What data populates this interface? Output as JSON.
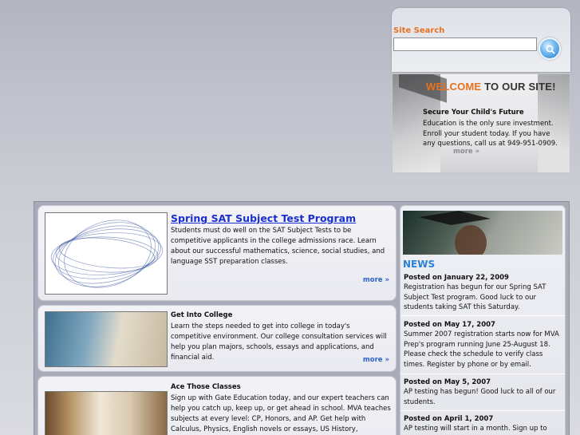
{
  "search": {
    "label": "Site Search",
    "value": "",
    "placeholder": ""
  },
  "welcome": {
    "title_part1": "WELCOME",
    "title_part2": "TO OUR SITE!",
    "subtitle": "Secure Your Child's Future",
    "body": "Education is the only sure investment. Enroll your student today. If you have any questions, call us at 949-951-0909.",
    "more": "more »"
  },
  "cards": [
    {
      "title": "Spring SAT Subject Test Program",
      "body": "Students must do well on the SAT Subject Tests to be competitive applicants in the college admissions race. Learn about our successful mathematics, science, social studies, and language SST preparation classes.",
      "more": "more »"
    },
    {
      "title": "Get Into College",
      "body": "Learn the steps needed to get into college in today's competitive environment. Our college consultation services will help you plan majors, schools, essays and applications, and financial aid.",
      "more": "more »"
    },
    {
      "title": "Ace Those Classes",
      "body": "Sign up with Gate Education today, and our expert teachers can help you catch up, keep up, or get ahead in school. MVA teaches subjects at every level: CP, Honors, and AP. Get help with Calculus, Physics, English novels or essays, US History,"
    }
  ],
  "news": {
    "title": "NEWS",
    "items": [
      {
        "date": "Posted on January 22, 2009",
        "text": "Registration has begun for our Spring SAT Subject Test program. Good luck to our students taking SAT this Saturday."
      },
      {
        "date": "Posted on May 17, 2007",
        "text": "Summer 2007 registration starts now for MVA Prep's program running June 25-August 18. Please check the schedule to verify class times. Register by phone or by email."
      },
      {
        "date": "Posted on May 5, 2007",
        "text": "AP testing has begun! Good luck to all of our students."
      },
      {
        "date": "Posted on April 1, 2007",
        "text": "AP testing will start in a month. Sign up to"
      }
    ]
  },
  "colors": {
    "accent_orange": "#e8711e",
    "link_blue": "#1a2fd0",
    "news_blue": "#2b82d2"
  }
}
